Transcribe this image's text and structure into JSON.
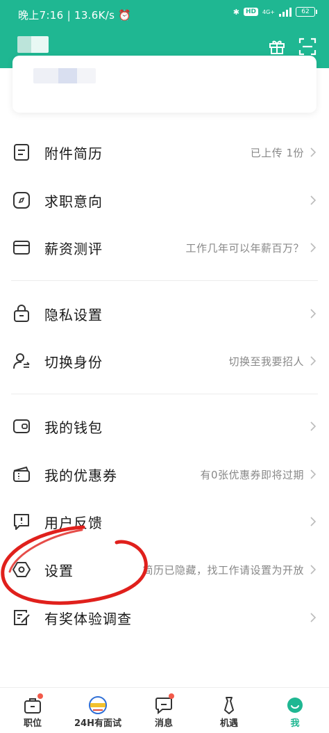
{
  "status_bar": {
    "time": "晚上7:16",
    "speed": "13.6K/s",
    "network": "4G+",
    "battery": "62"
  },
  "colors": {
    "brand": "#1fb792",
    "annotation": "#e0201c",
    "badge": "#f25a4a"
  },
  "header_icons": [
    "gift-icon",
    "scan-icon"
  ],
  "menu": {
    "resume": {
      "label": "附件简历",
      "sub": "已上传 1份"
    },
    "intent": {
      "label": "求职意向",
      "sub": ""
    },
    "salary": {
      "label": "薪资测评",
      "sub": "工作几年可以年薪百万？"
    },
    "privacy": {
      "label": "隐私设置",
      "sub": ""
    },
    "switch_identity": {
      "label": "切换身份",
      "sub": "切换至我要招人"
    },
    "wallet": {
      "label": "我的钱包",
      "sub": ""
    },
    "coupons": {
      "label": "我的优惠券",
      "sub": "有0张优惠券即将过期"
    },
    "feedback": {
      "label": "用户反馈",
      "sub": ""
    },
    "settings": {
      "label": "设置",
      "sub": "简历已隐藏，找工作请设置为开放"
    },
    "survey": {
      "label": "有奖体验调查",
      "sub": ""
    }
  },
  "tabs": [
    {
      "label": "职位",
      "icon": "briefcase-icon"
    },
    {
      "label": "24H有面试",
      "icon": "offer-badge-icon"
    },
    {
      "label": "消息",
      "icon": "message-icon"
    },
    {
      "label": "机遇",
      "icon": "tie-icon"
    },
    {
      "label": "我",
      "icon": "profile-smile-icon",
      "active": true
    }
  ]
}
